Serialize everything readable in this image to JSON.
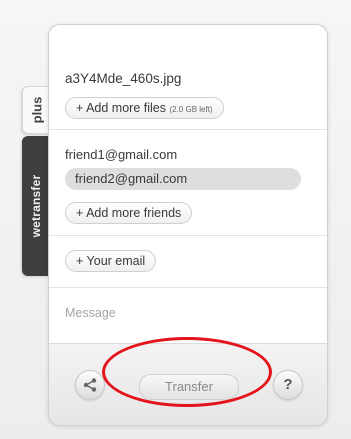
{
  "side_tabs": {
    "plus_label": "plus",
    "wetransfer_label": "wetransfer"
  },
  "files": {
    "filename": "a3Y4Mde_460s.jpg",
    "add_more_files_label": "+ Add more files",
    "space_left": "(2.0 GB left)"
  },
  "friends": {
    "emails": [
      "friend1@gmail.com",
      "friend2@gmail.com"
    ],
    "add_more_friends_label": "+ Add more friends"
  },
  "your_email": {
    "label": "+ Your email"
  },
  "message": {
    "placeholder": "Message"
  },
  "footer": {
    "transfer_label": "Transfer",
    "help_label": "?",
    "share_icon": "share-icon"
  },
  "colors": {
    "annotation_circle": "#e4141b",
    "side_tab_dark": "#3e3e3e"
  }
}
